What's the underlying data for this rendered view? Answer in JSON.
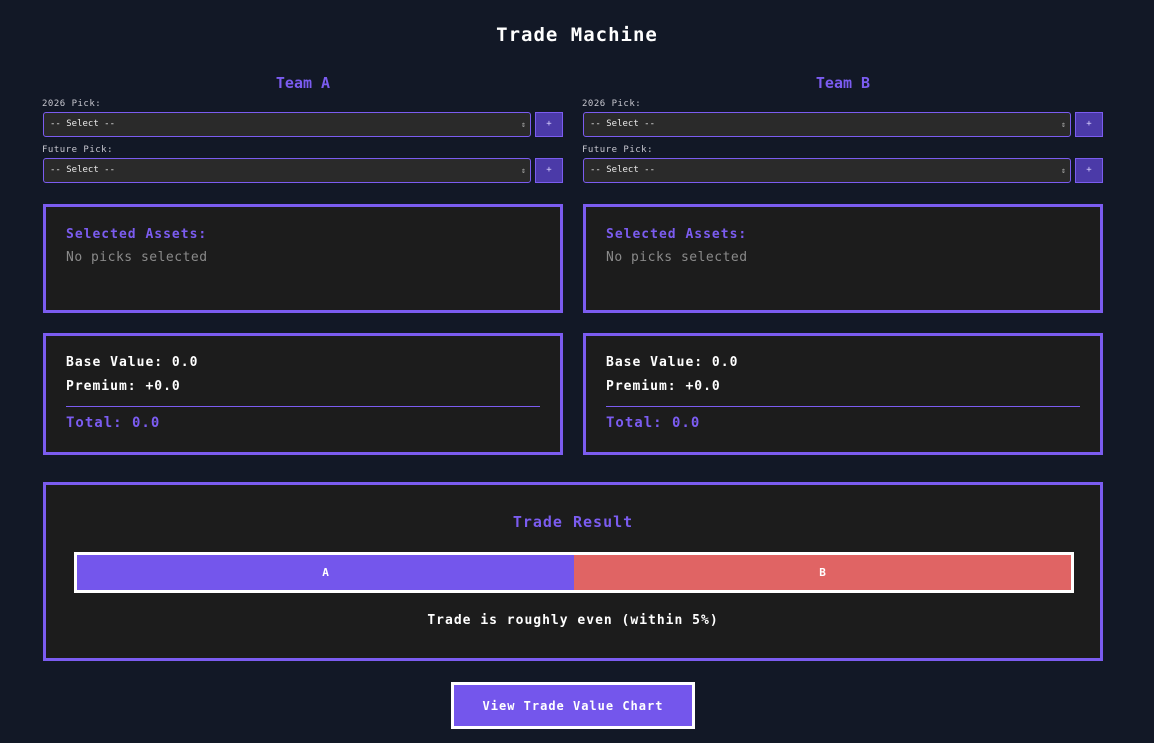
{
  "app": {
    "title": "Trade Machine"
  },
  "team_a": {
    "name": "Team A",
    "pick_2026_label": "2026 Pick:",
    "pick_2026_value": "-- Select --",
    "future_pick_label": "Future Pick:",
    "future_pick_value": "-- Select --",
    "add_label": "+",
    "assets_title": "Selected Assets:",
    "assets_empty": "No picks selected",
    "base_value": "Base Value: 0.0",
    "premium": "Premium: +0.0",
    "total": "Total: 0.0"
  },
  "team_b": {
    "name": "Team B",
    "pick_2026_label": "2026 Pick:",
    "pick_2026_value": "-- Select --",
    "future_pick_label": "Future Pick:",
    "future_pick_value": "-- Select --",
    "add_label": "+",
    "assets_title": "Selected Assets:",
    "assets_empty": "No picks selected",
    "base_value": "Base Value: 0.0",
    "premium": "Premium: +0.0",
    "total": "Total: 0.0"
  },
  "result": {
    "title": "Trade Result",
    "bar_a_label": "A",
    "bar_b_label": "B",
    "bar_a_share": 0.5,
    "message": "Trade is roughly even (within 5%)",
    "colors": {
      "a": "#7456EC",
      "b": "#E06464"
    }
  },
  "chart_button": {
    "label": "View Trade Value Chart"
  }
}
